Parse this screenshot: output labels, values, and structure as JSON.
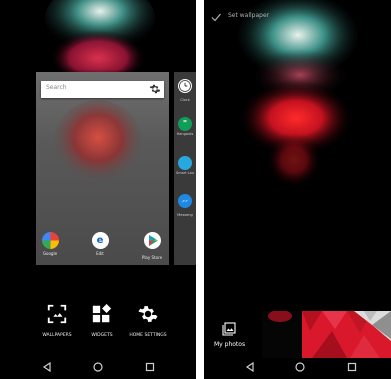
{
  "left": {
    "search_placeholder": "Search",
    "card_apps": [
      {
        "label": "Google",
        "icon": "google-photos-icon"
      },
      {
        "label": "Edit",
        "icon": "edit-app-icon"
      },
      {
        "label": "Play Store",
        "icon": "play-store-icon"
      }
    ],
    "side_apps": [
      {
        "label": "Clock",
        "icon": "clock-icon"
      },
      {
        "label": "Hangouts",
        "icon": "hangouts-icon"
      },
      {
        "label": "Smart Lau",
        "icon": "smart-launcher-icon"
      },
      {
        "label": "Messeng",
        "icon": "messenger-icon"
      }
    ],
    "options": [
      {
        "label": "WALLPAPERS",
        "icon": "wallpapers-icon"
      },
      {
        "label": "WIDGETS",
        "icon": "widgets-icon"
      },
      {
        "label": "HOME SETTINGS",
        "icon": "gear-icon"
      }
    ]
  },
  "right": {
    "set_wallpaper_label": "Set wallpaper",
    "my_photos_label": "My photos"
  },
  "colors": {
    "accent_red": "#d9182b",
    "background": "#000000",
    "card_gray": "#5a5a5a"
  }
}
